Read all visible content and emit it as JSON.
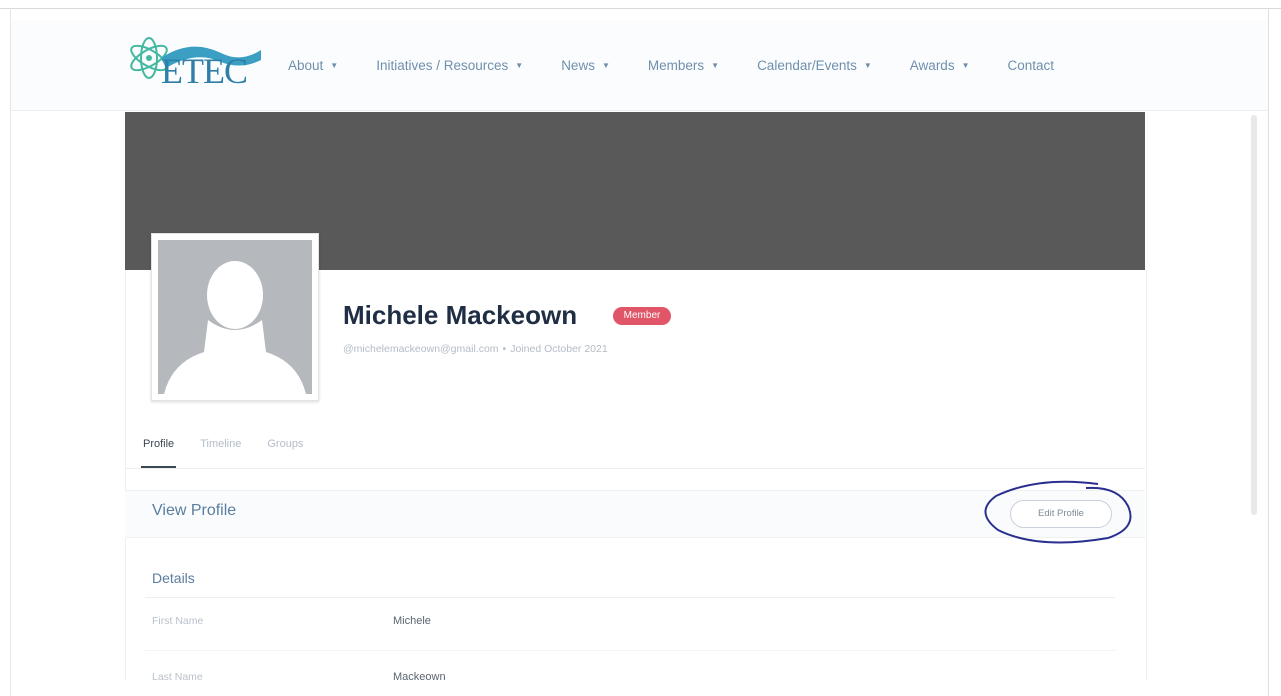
{
  "header": {
    "logo_text": "ETEC",
    "nav": [
      {
        "label": "About",
        "has_dropdown": true
      },
      {
        "label": "Initiatives / Resources",
        "has_dropdown": true
      },
      {
        "label": "News",
        "has_dropdown": true
      },
      {
        "label": "Members",
        "has_dropdown": true
      },
      {
        "label": "Calendar/Events",
        "has_dropdown": true
      },
      {
        "label": "Awards",
        "has_dropdown": true
      },
      {
        "label": "Contact",
        "has_dropdown": false
      }
    ]
  },
  "profile": {
    "name": "Michele Mackeown",
    "badge": "Member",
    "handle": "@michelemackeown@gmail.com",
    "separator": "•",
    "joined": "Joined October 2021"
  },
  "tabs": [
    "Profile",
    "Timeline",
    "Groups"
  ],
  "view": {
    "title": "View Profile",
    "edit_label": "Edit Profile"
  },
  "details": {
    "title": "Details",
    "rows": [
      {
        "label": "First Name",
        "value": "Michele"
      },
      {
        "label": "Last Name",
        "value": "Mackeown"
      }
    ]
  },
  "colors": {
    "cover": "#595959",
    "badge": "#e05568",
    "accent": "#5a7da0",
    "annotation": "#2a2f8f"
  }
}
